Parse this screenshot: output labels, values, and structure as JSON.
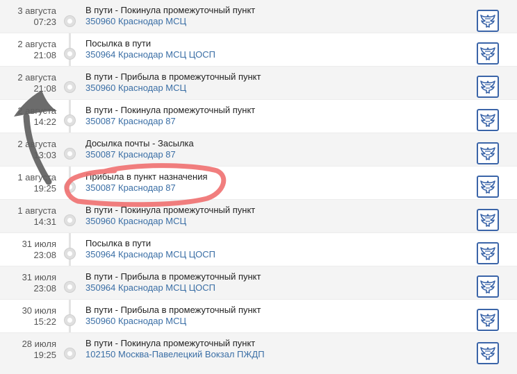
{
  "tracking": {
    "events": [
      {
        "date": "3 августа",
        "time": "07:23",
        "status": "В пути - Покинула промежуточный пункт",
        "place": "350960 Краснодар МСЦ",
        "logo_icon": "russian-post-eagle-icon"
      },
      {
        "date": "2 августа",
        "time": "21:08",
        "status": "Посылка в пути",
        "place": "350964 Краснодар МСЦ ЦОСП",
        "logo_icon": "russian-post-eagle-icon"
      },
      {
        "date": "2 августа",
        "time": "21:08",
        "status": "В пути - Прибыла в промежуточный пункт",
        "place": "350960 Краснодар МСЦ",
        "logo_icon": "russian-post-eagle-icon"
      },
      {
        "date": "2 августа",
        "time": "14:22",
        "status": "В пути - Покинула промежуточный пункт",
        "place": "350087 Краснодар 87",
        "logo_icon": "russian-post-eagle-icon"
      },
      {
        "date": "2 августа",
        "time": "13:03",
        "status": "Досылка почты - Засылка",
        "place": "350087 Краснодар 87",
        "logo_icon": "russian-post-eagle-icon"
      },
      {
        "date": "1 августа",
        "time": "19:25",
        "status": "Прибыла в пункт назначения",
        "place": "350087 Краснодар 87",
        "logo_icon": "russian-post-eagle-icon"
      },
      {
        "date": "1 августа",
        "time": "14:31",
        "status": "В пути - Покинула промежуточный пункт",
        "place": "350960 Краснодар МСЦ",
        "logo_icon": "russian-post-eagle-icon"
      },
      {
        "date": "31 июля",
        "time": "23:08",
        "status": "Посылка в пути",
        "place": "350964 Краснодар МСЦ ЦОСП",
        "logo_icon": "russian-post-eagle-icon"
      },
      {
        "date": "31 июля",
        "time": "23:08",
        "status": "В пути - Прибыла в промежуточный пункт",
        "place": "350964 Краснодар МСЦ ЦОСП",
        "logo_icon": "russian-post-eagle-icon"
      },
      {
        "date": "30 июля",
        "time": "15:22",
        "status": "В пути - Прибыла в промежуточный пункт",
        "place": "350960 Краснодар МСЦ",
        "logo_icon": "russian-post-eagle-icon"
      },
      {
        "date": "28 июля",
        "time": "19:25",
        "status": "В пути - Покинула промежуточный пункт",
        "place": "102150 Москва-Павелецкий Вокзал ПЖДП",
        "logo_icon": "russian-post-eagle-icon"
      }
    ]
  },
  "annotations": {
    "highlight_color": "#f07070",
    "arrow_color": "#606060",
    "circled_event": "Прибыла в пункт назначения"
  },
  "colors": {
    "place_link": "#3a6ea5",
    "logo_border": "#3a64a8",
    "timeline": "#e3e3e3"
  }
}
